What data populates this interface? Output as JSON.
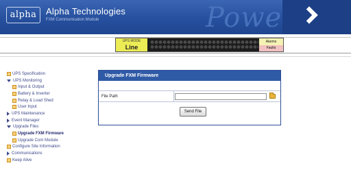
{
  "header": {
    "logo_text": "alpha",
    "company": "Alpha Technologies",
    "module": "FXM Communication Module",
    "power_word": "Power"
  },
  "status_bar": {
    "ups_mode_label": "UPS MODE",
    "ups_mode_value": "Line",
    "alarms_label": "Alarms",
    "faults_label": "Faults"
  },
  "sidebar": {
    "items": [
      {
        "label": "UPS Specification",
        "icon": "document-icon",
        "level": 0
      },
      {
        "label": "UPS Monitoring",
        "icon": "expanded-arrow-icon",
        "level": 0
      },
      {
        "label": "Input & Output",
        "icon": "document-icon",
        "level": 1
      },
      {
        "label": "Battery & Inverter",
        "icon": "document-icon",
        "level": 1
      },
      {
        "label": "Relay & Load Shed",
        "icon": "document-icon",
        "level": 1
      },
      {
        "label": "User Input",
        "icon": "document-icon",
        "level": 1
      },
      {
        "label": "UPS Maintenance",
        "icon": "collapsed-arrow-icon",
        "level": 0
      },
      {
        "label": "Event Manager",
        "icon": "collapsed-arrow-icon",
        "level": 0
      },
      {
        "label": "Upgrade Files",
        "icon": "expanded-arrow-icon",
        "level": 0
      },
      {
        "label": "Upgrade FXM Firmware",
        "icon": "document-icon",
        "level": 1,
        "active": true
      },
      {
        "label": "Upgrade Com Module",
        "icon": "document-icon",
        "level": 1
      },
      {
        "label": "Configure Site Information",
        "icon": "document-icon",
        "level": 0
      },
      {
        "label": "Communications",
        "icon": "collapsed-arrow-icon",
        "level": 0
      },
      {
        "label": "Keep Alive",
        "icon": "document-icon",
        "level": 0
      }
    ]
  },
  "panel": {
    "title": "Upgrade FXM Firmware",
    "file_path_label": "File Path",
    "file_path_value": "",
    "send_button": "Send File"
  },
  "colors": {
    "header_blue": "#26509e",
    "nav_text": "#3f4a8a",
    "panel_title_bg": "#2f5aa6",
    "ups_mode_bg": "#ecec55",
    "alarms_bg": "#f4f1b4",
    "faults_bg": "#f1c0c0"
  }
}
